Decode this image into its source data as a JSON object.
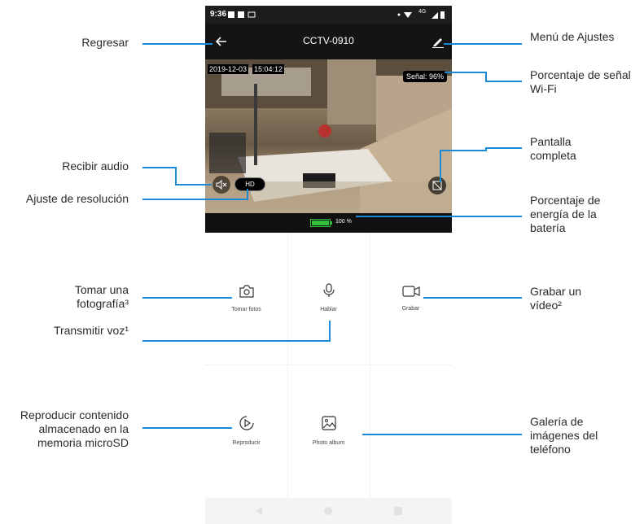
{
  "status_bar": {
    "time": "9:36",
    "signal": "4G"
  },
  "app_bar": {
    "title": "CCTV-0910",
    "back_icon": "arrow-left-icon",
    "edit_icon": "pencil-icon"
  },
  "video": {
    "date": "2019-12-03",
    "time": "15:04:12",
    "signal": "Señal: 96%",
    "resolution": "HD"
  },
  "battery": {
    "percent_label": "100 %",
    "level": 1.0,
    "color": "#2fbf3a"
  },
  "controls": [
    {
      "label": "Tomar fotos",
      "icon": "camera-icon"
    },
    {
      "label": "Hablar",
      "icon": "microphone-icon"
    },
    {
      "label": "Grabar",
      "icon": "video-camera-icon"
    },
    {
      "label": "Reproducir",
      "icon": "play-circle-icon"
    },
    {
      "label": "Photo album",
      "icon": "image-icon"
    }
  ],
  "callouts": {
    "back": "Regresar",
    "settings_menu": "Menú de Ajustes",
    "wifi": "Porcentaje de señal Wi-Fi",
    "fullscreen": "Pantalla completa",
    "audio": "Recibir audio",
    "resolution": "Ajuste de resolución",
    "battery": "Porcentaje de energía de la batería",
    "photo": "Tomar una fotografía³",
    "record": "Grabar un vídeo²",
    "talk": "Transmitir voz¹",
    "playback": "Reproducir contenido almacenado en la memoria microSD",
    "gallery": "Galería de imágenes del teléfono"
  },
  "colors": {
    "accent": "#1a8ad4",
    "bar": "#141414"
  }
}
